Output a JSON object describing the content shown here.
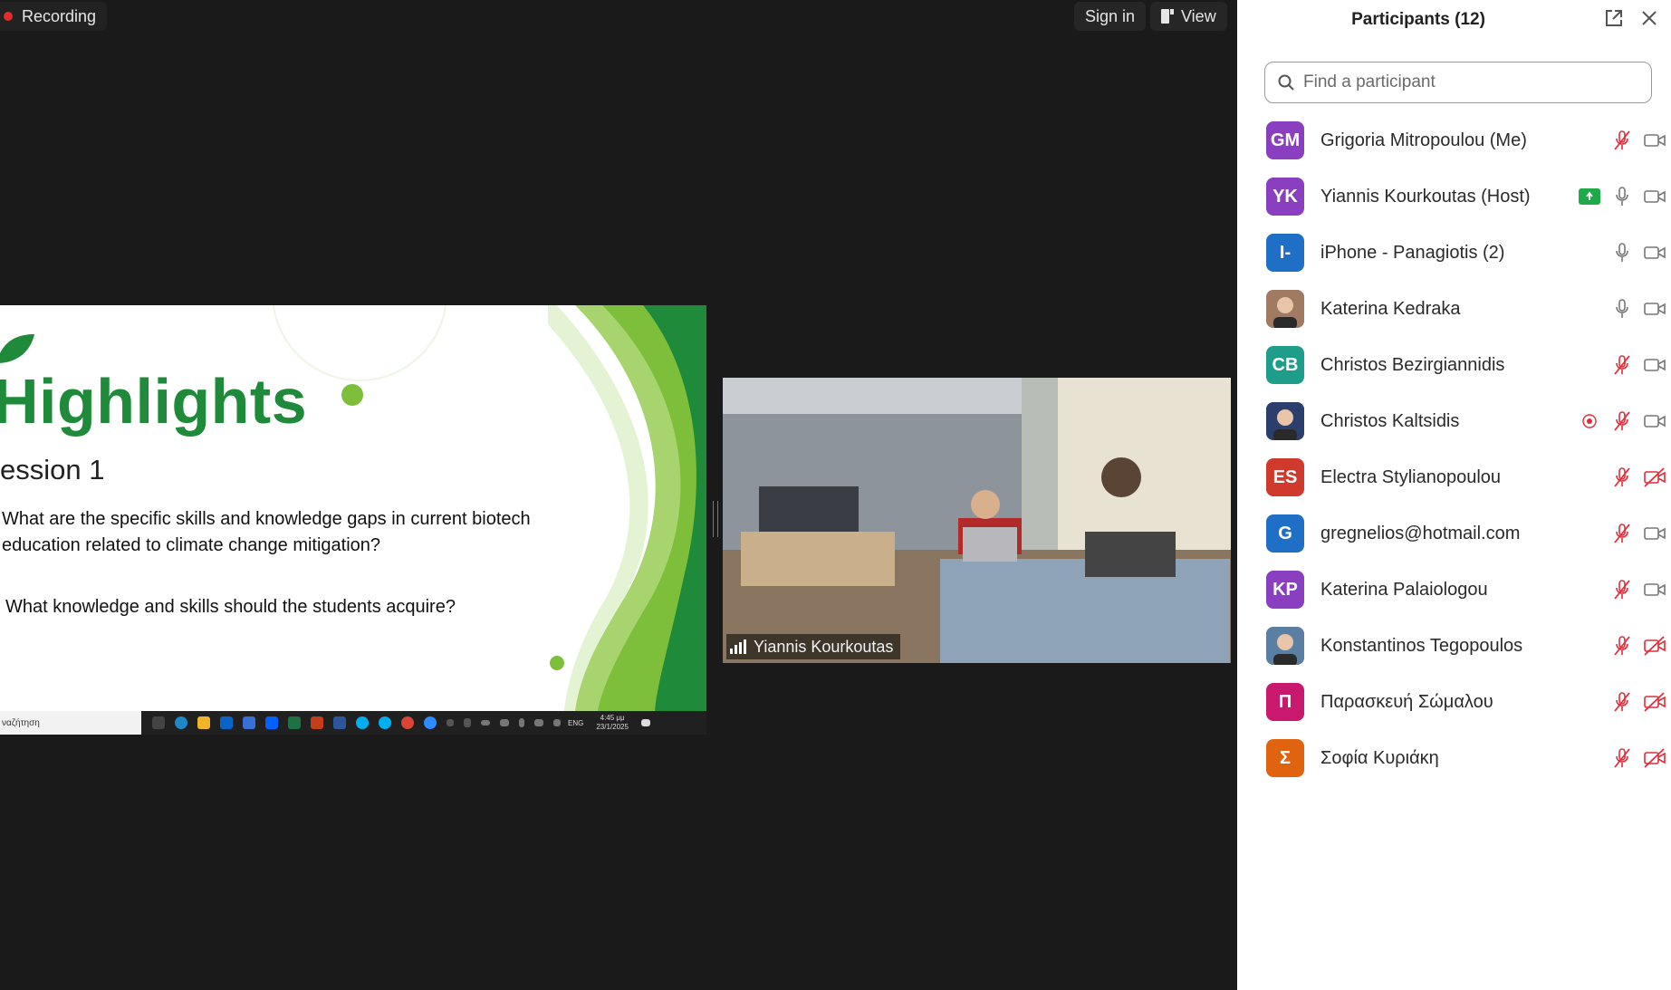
{
  "recording": {
    "label": "Recording"
  },
  "topbar": {
    "sign_in": "Sign in",
    "view": "View"
  },
  "slide": {
    "title": "Highlights",
    "subtitle": "ession 1",
    "question1": "What are the specific skills and knowledge gaps in current biotech education related to climate change mitigation?",
    "question2": "What knowledge and skills should the students acquire?",
    "taskbar_search": "ναζήτηση",
    "taskbar_lang": "ENG",
    "taskbar_time": "4:45 μμ",
    "taskbar_date": "23/1/2025"
  },
  "video": {
    "name": "Yiannis Kourkoutas"
  },
  "panel": {
    "title": "Participants (12)",
    "search_placeholder": "Find a participant",
    "colors": {
      "mic_muted": "#e02e3a",
      "icon_gray": "#777777",
      "share_green": "#1faa4a"
    },
    "participants": [
      {
        "initials": "GM",
        "name": "Grigoria Mitropoulou (Me)",
        "avatar_color": "#8a3fc0",
        "mic": "muted",
        "video": "on"
      },
      {
        "initials": "YK",
        "name": "Yiannis Kourkoutas (Host)",
        "avatar_color": "#8a3fc0",
        "mic": "on",
        "video": "on",
        "sharing": true
      },
      {
        "initials": "I-",
        "name": "iPhone - Panagiotis (2)",
        "avatar_color": "#1f6fc7",
        "mic": "on",
        "video": "on"
      },
      {
        "initials": "",
        "name": "Katerina Kedraka",
        "avatar_color": "#a07a62",
        "mic": "on",
        "video": "on",
        "photo": true
      },
      {
        "initials": "CB",
        "name": "Christos Bezirgiannidis",
        "avatar_color": "#1e9e8a",
        "mic": "muted",
        "video": "on"
      },
      {
        "initials": "",
        "name": "Christos Kaltsidis",
        "avatar_color": "#2c3e6b",
        "mic": "muted",
        "video": "on",
        "photo": true,
        "recording": true
      },
      {
        "initials": "ES",
        "name": "Electra Stylianopoulou",
        "avatar_color": "#d03a2c",
        "mic": "muted",
        "video": "off"
      },
      {
        "initials": "G",
        "name": "gregnelios@hotmail.com",
        "avatar_color": "#1f6fc7",
        "mic": "muted",
        "video": "on"
      },
      {
        "initials": "KP",
        "name": "Katerina Palaiologou",
        "avatar_color": "#8a3fc0",
        "mic": "muted",
        "video": "on"
      },
      {
        "initials": "",
        "name": "Konstantinos Tegopoulos",
        "avatar_color": "#5b7fa3",
        "mic": "muted",
        "video": "off",
        "photo": true
      },
      {
        "initials": "Π",
        "name": "Παρασκευή Σώμαλου",
        "avatar_color": "#c8196e",
        "mic": "muted",
        "video": "off"
      },
      {
        "initials": "Σ",
        "name": "Σοφία Κυριάκη",
        "avatar_color": "#e0640f",
        "mic": "muted",
        "video": "off"
      }
    ]
  }
}
